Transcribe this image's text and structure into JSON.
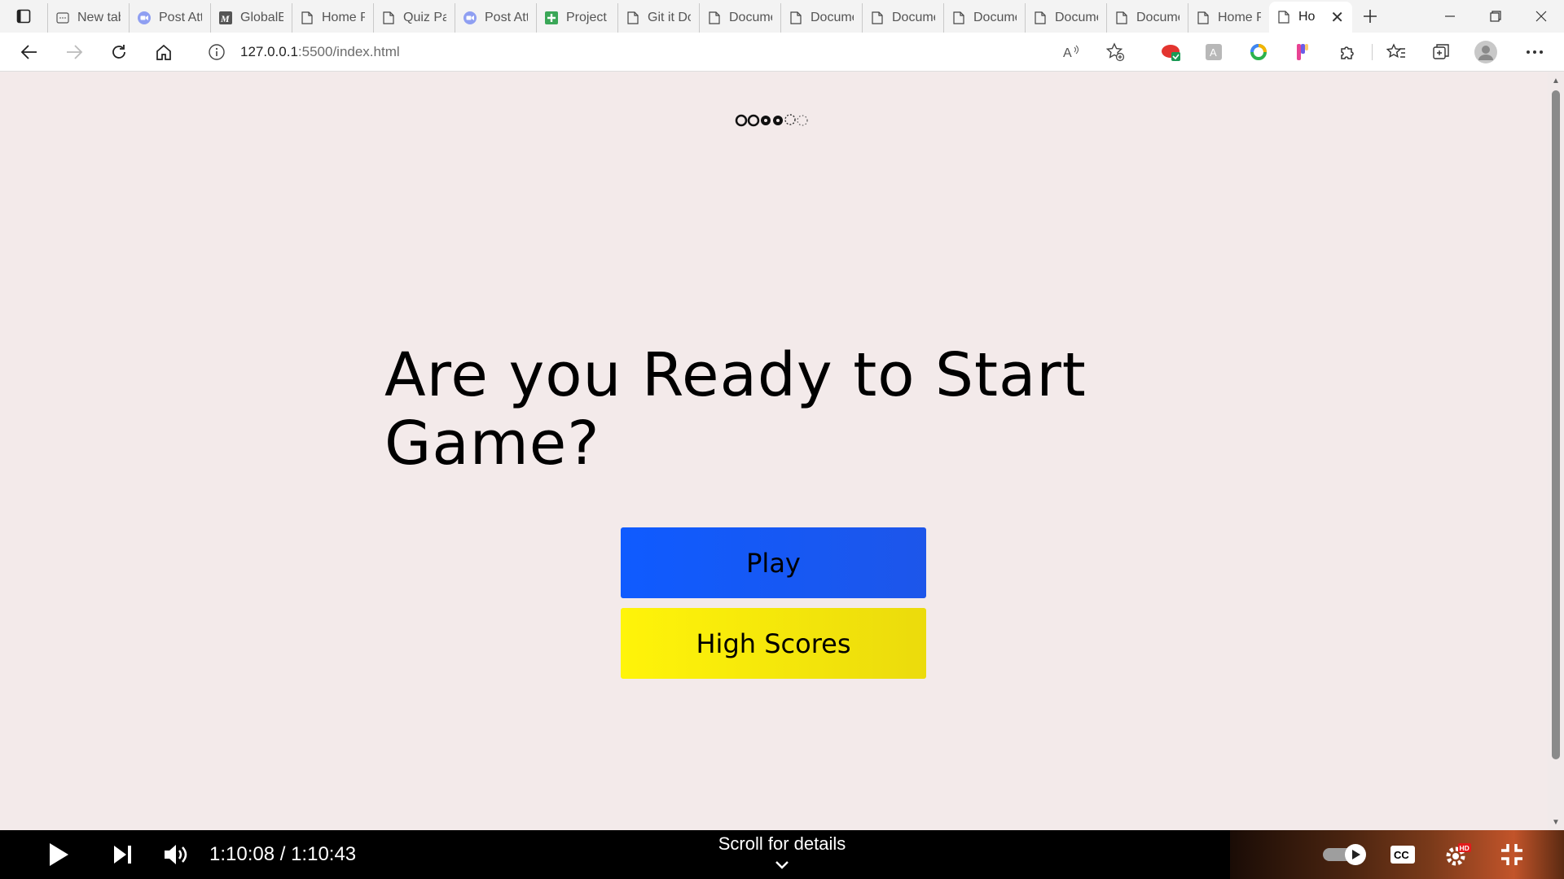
{
  "browser": {
    "tabs": [
      {
        "label": "New tab",
        "icon": "new-tab-icon"
      },
      {
        "label": "Post Att",
        "icon": "zoom-icon"
      },
      {
        "label": "GlobalE",
        "icon": "m-logo-icon"
      },
      {
        "label": "Home P",
        "icon": "page-icon"
      },
      {
        "label": "Quiz Pa",
        "icon": "page-icon"
      },
      {
        "label": "Post Att",
        "icon": "zoom-icon"
      },
      {
        "label": "Project",
        "icon": "plus-sheet-icon"
      },
      {
        "label": "Git it Do",
        "icon": "page-icon"
      },
      {
        "label": "Docume",
        "icon": "page-icon"
      },
      {
        "label": "Docume",
        "icon": "page-icon"
      },
      {
        "label": "Docume",
        "icon": "page-icon"
      },
      {
        "label": "Docume",
        "icon": "page-icon"
      },
      {
        "label": "Docume",
        "icon": "page-icon"
      },
      {
        "label": "Docume",
        "icon": "page-icon"
      },
      {
        "label": "Home P",
        "icon": "page-icon"
      }
    ],
    "active_tab": {
      "label": "Ho",
      "icon": "page-icon"
    },
    "address": {
      "host": "127.0.0.1",
      "rest": ":5500/index.html"
    }
  },
  "page": {
    "headline": "Are you Ready to Start Game?",
    "play_label": "Play",
    "highscores_label": "High Scores"
  },
  "video": {
    "time": "1:10:08 / 1:10:43",
    "scroll_hint": "Scroll for details"
  },
  "colors": {
    "page_bg": "#f3eaea",
    "play_button": "#0f5bff",
    "highscores_button": "#fff409"
  }
}
